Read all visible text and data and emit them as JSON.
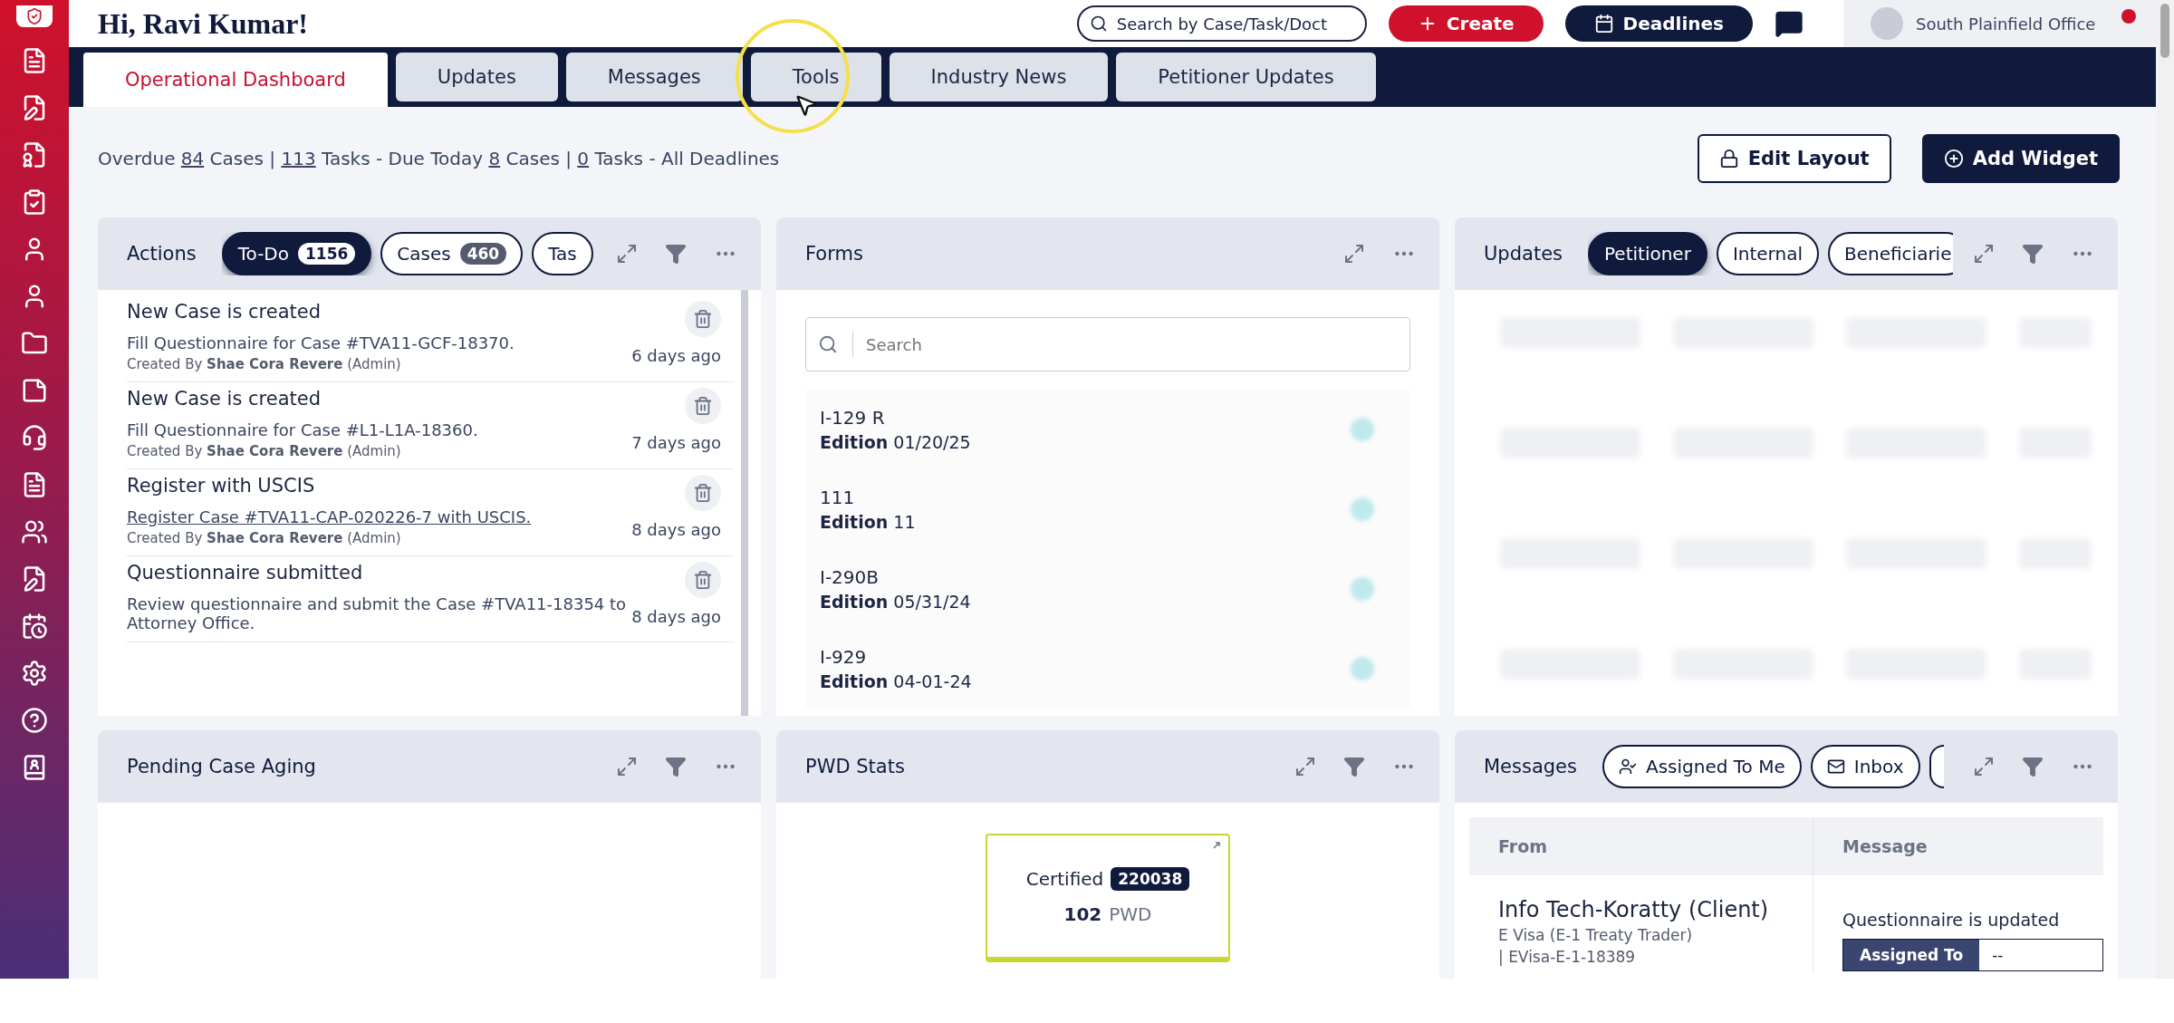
{
  "header": {
    "greeting": "Hi, Ravi Kumar!",
    "search": {
      "placeholder": "Search by Case/Task/Doct"
    },
    "create_button": "Create",
    "deadlines_button": "Deadlines",
    "office": "South Plainfield Office"
  },
  "tabs": [
    {
      "label": "Operational Dashboard",
      "selected": true
    },
    {
      "label": "Updates",
      "selected": false
    },
    {
      "label": "Messages",
      "selected": false
    },
    {
      "label": "Tools",
      "selected": false
    },
    {
      "label": "Industry News",
      "selected": false
    },
    {
      "label": "Petitioner Updates",
      "selected": false
    }
  ],
  "summary": [
    {
      "text": "Overdue ",
      "link": false
    },
    {
      "text": "84",
      "link": true
    },
    {
      "text": " Cases | ",
      "link": false
    },
    {
      "text": "113",
      "link": true
    },
    {
      "text": " Tasks - Due Today ",
      "link": false
    },
    {
      "text": "8",
      "link": true
    },
    {
      "text": " Cases | ",
      "link": false
    },
    {
      "text": "0",
      "link": true
    },
    {
      "text": " Tasks - All Deadlines",
      "link": false
    }
  ],
  "toolbar_buttons": [
    {
      "label": "Edit Layout",
      "kind": "outline"
    },
    {
      "label": "Add Widget",
      "kind": "solid"
    }
  ],
  "actions": {
    "title": "Actions",
    "chips": [
      {
        "label": "To-Do",
        "count": "1156",
        "selected": true
      },
      {
        "label": "Cases",
        "count": "460",
        "selected": false
      },
      {
        "label": "Tas",
        "selected": false
      }
    ],
    "items": [
      {
        "title": "New Case is created",
        "description": "Fill Questionnaire for Case #TVA11-GCF-18370.",
        "link": false,
        "created_by": "Created By **Shae Cora Revere** (Admin)",
        "time": "6 days ago"
      },
      {
        "title": "New Case is created",
        "description": "Fill Questionnaire for Case #L1-L1A-18360.",
        "link": false,
        "created_by": "Created By **Shae Cora Revere** (Admin)",
        "time": "7 days ago"
      },
      {
        "title": "Register with USCIS",
        "description": "Register Case #TVA11-CAP-020226-7 with USCIS.",
        "link": true,
        "created_by": "Created By **Shae Cora Revere** (Admin)",
        "time": "8 days ago"
      },
      {
        "title": "Questionnaire submitted",
        "description": "Review questionnaire and submit the Case #TVA11-18354 to Attorney Office.",
        "link": false,
        "time": "8 days ago"
      }
    ]
  },
  "forms": {
    "title": "Forms",
    "search": {
      "placeholder": "Search"
    },
    "items": [
      {
        "name": "I-129 R",
        "edition": "**Edition** 01/20/25"
      },
      {
        "name": "111",
        "edition": "**Edition** 11"
      },
      {
        "name": "I-290B",
        "edition": "**Edition** 05/31/24"
      },
      {
        "name": "I-929",
        "edition": "**Edition** 04-01-24"
      }
    ]
  },
  "updates": {
    "title": "Updates",
    "chips": [
      {
        "label": "Petitioner",
        "selected": true
      },
      {
        "label": "Internal",
        "selected": false
      },
      {
        "label": "Beneficiarie",
        "selected": false
      }
    ]
  },
  "pending_case_aging": {
    "title": "Pending Case Aging"
  },
  "pwd_stats": {
    "title": "PWD Stats",
    "card": {
      "label": "Certified",
      "badge": "220038",
      "count": "102",
      "unit": "PWD"
    }
  },
  "messages": {
    "title": "Messages",
    "chips": [
      {
        "label": "Assigned To Me",
        "kind": "user",
        "selected": false
      },
      {
        "label": "Inbox",
        "kind": "mail",
        "selected": false
      },
      {
        "kind": "cut",
        "selected": false
      }
    ],
    "columns": [
      "From",
      "Message"
    ],
    "rows": [
      {
        "from": "Info Tech-Koratty (Client)",
        "visa": "E Visa (E-1 Treaty Trader)",
        "case": "| EVisa-E-1-18389",
        "message": "Questionnaire is updated",
        "assigned_label": "Assigned To",
        "assigned_value": "--"
      }
    ]
  }
}
